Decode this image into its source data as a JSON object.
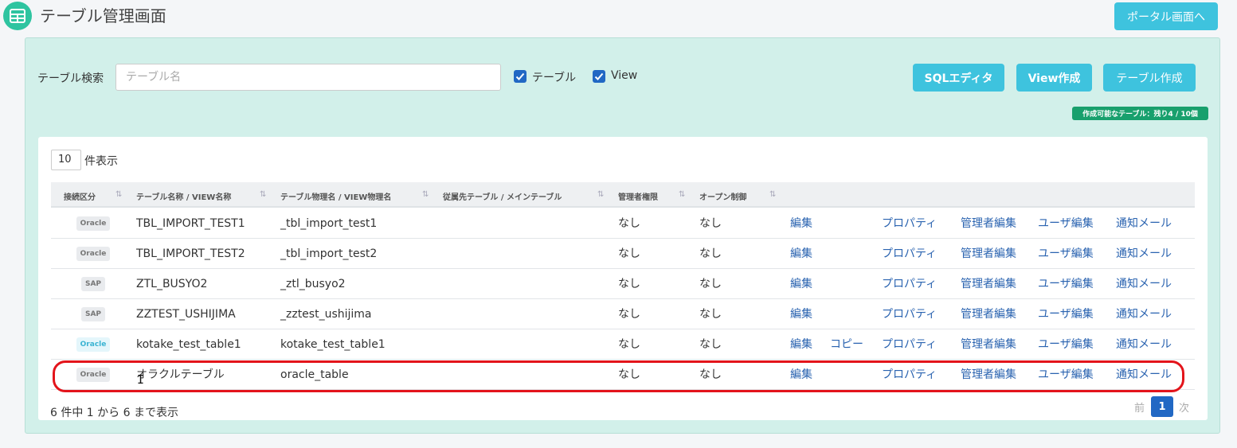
{
  "header": {
    "title": "テーブル管理画面",
    "portal_button": "ポータル画面へ",
    "app_icon": "table-grid-icon"
  },
  "search": {
    "label": "テーブル検索",
    "placeholder": "テーブル名",
    "filters": [
      {
        "label": "テーブル",
        "checked": true
      },
      {
        "label": "View",
        "checked": true
      }
    ]
  },
  "actions": {
    "sql_editor": "SQLエディタ",
    "create_view": "View作成",
    "create_table": "テーブル作成"
  },
  "quota_badge": "作成可能なテーブル：残り4 / 10個",
  "table": {
    "page_length": "10",
    "page_length_suffix": "件表示",
    "columns": [
      "接続区分",
      "テーブル名称 / VIEW名称",
      "テーブル物理名 / VIEW物理名",
      "従属先テーブル / メインテーブル",
      "管理者権限",
      "オープン制御"
    ],
    "sort_icon": "sort-arrows-icon",
    "rows": [
      {
        "conn": "Oracle",
        "conn_style": "grey",
        "name": "TBL_IMPORT_TEST1",
        "physical": "_tbl_import_test1",
        "parent": "",
        "admin": "なし",
        "open": "なし",
        "links": [
          "編集",
          "",
          "プロパティ",
          "管理者編集",
          "ユーザ編集",
          "通知メール"
        ]
      },
      {
        "conn": "Oracle",
        "conn_style": "grey",
        "name": "TBL_IMPORT_TEST2",
        "physical": "_tbl_import_test2",
        "parent": "",
        "admin": "なし",
        "open": "なし",
        "links": [
          "編集",
          "",
          "プロパティ",
          "管理者編集",
          "ユーザ編集",
          "通知メール"
        ]
      },
      {
        "conn": "SAP",
        "conn_style": "grey",
        "name": "ZTL_BUSYO2",
        "physical": "_ztl_busyo2",
        "parent": "",
        "admin": "なし",
        "open": "なし",
        "links": [
          "編集",
          "",
          "プロパティ",
          "管理者編集",
          "ユーザ編集",
          "通知メール"
        ]
      },
      {
        "conn": "SAP",
        "conn_style": "grey",
        "name": "ZZTEST_USHIJIMA",
        "physical": "_zztest_ushijima",
        "parent": "",
        "admin": "なし",
        "open": "なし",
        "links": [
          "編集",
          "",
          "プロパティ",
          "管理者編集",
          "ユーザ編集",
          "通知メール"
        ]
      },
      {
        "conn": "Oracle",
        "conn_style": "light",
        "name": "kotake_test_table1",
        "physical": "kotake_test_table1",
        "parent": "",
        "admin": "なし",
        "open": "なし",
        "links": [
          "編集",
          "コピー",
          "プロパティ",
          "管理者編集",
          "ユーザ編集",
          "通知メール"
        ]
      },
      {
        "conn": "Oracle",
        "conn_style": "grey",
        "name": "オラクルテーブル",
        "physical": "oracle_table",
        "parent": "",
        "admin": "なし",
        "open": "なし",
        "links": [
          "編集",
          "",
          "プロパティ",
          "管理者編集",
          "ユーザ編集",
          "通知メール"
        ]
      }
    ],
    "info": "6 件中 1 から 6 まで表示",
    "pagination": {
      "prev": "前",
      "current": "1",
      "next": "次"
    }
  }
}
